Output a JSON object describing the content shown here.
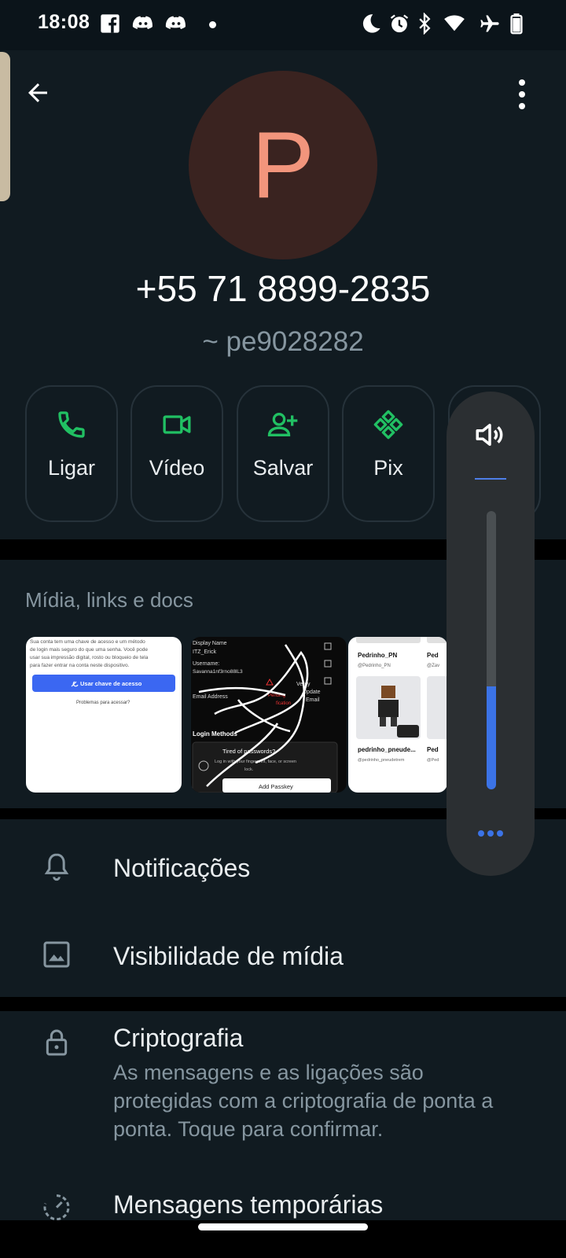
{
  "status_bar": {
    "time": "18:08",
    "icons": [
      "facebook-icon",
      "discord-icon",
      "discord-icon",
      "notification-dot",
      "moon-icon",
      "alarm-icon",
      "bluetooth-icon",
      "wifi-icon",
      "airplane-icon",
      "battery-icon"
    ]
  },
  "header": {
    "avatar_letter": "P",
    "avatar_bg": "#3a2320",
    "avatar_fg": "#f2957c",
    "phone_number": "+55 71 8899-2835",
    "push_name": "~ pe9028282"
  },
  "actions": [
    {
      "label": "Ligar",
      "icon": "phone-icon"
    },
    {
      "label": "Vídeo",
      "icon": "video-icon"
    },
    {
      "label": "Salvar",
      "icon": "add-contact-icon"
    },
    {
      "label": "Pix",
      "icon": "pix-icon"
    }
  ],
  "media": {
    "title": "Mídia, links e docs",
    "thumbs": [
      {
        "line1": "Sua conta tem uma chave de acesso e um método",
        "line2": "de login mais seguro do que uma senha. Você pode",
        "line3": "usar sua impressão digital, rosto ou bloqueio de tela",
        "line4": "para fazer entrar na conta neste dispositivo.",
        "button": "Usar chave de acesso",
        "link": "Problemas para acessar?"
      },
      {
        "display_name": "Display Name",
        "display_value": "ITZ_Erick",
        "username_label": "Username:",
        "username_value": "Savanna1nf3rno88lL3",
        "email_label": "Email Address",
        "pending": "Pending",
        "verification": "fication",
        "verify": "Verify",
        "update": "Update",
        "email": "Email",
        "login_methods": "Login Methods",
        "tired": "Tired of passwords?",
        "login_hint": "Log in with your fingerprint, face, or screen",
        "lock": "lock.",
        "add_passkey": "Add Passkey"
      },
      {
        "user1_name": "Pedrinho_PN",
        "user1_handle": "@Pedrinho_PN",
        "user2_name": "Ped",
        "user2_handle": "@Zav",
        "user3_name": "pedrinho_pneude...",
        "user3_handle": "@pedrinho_pneudetrem",
        "user4_name": "Ped",
        "user4_handle": "@Ped"
      }
    ]
  },
  "settings": {
    "notifications": "Notificações",
    "media_visibility": "Visibilidade de mídia",
    "encryption_title": "Criptografia",
    "encryption_sub": "As mensagens e as ligações são protegidas com a criptografia de ponta a ponta. Toque para confirmar.",
    "disappearing": "Mensagens temporárias"
  },
  "volume": {
    "level": 0.37,
    "accent": "#3b73e6"
  },
  "colors": {
    "accent_green": "#21c063",
    "background": "#0b141a",
    "surface": "#111b21"
  }
}
